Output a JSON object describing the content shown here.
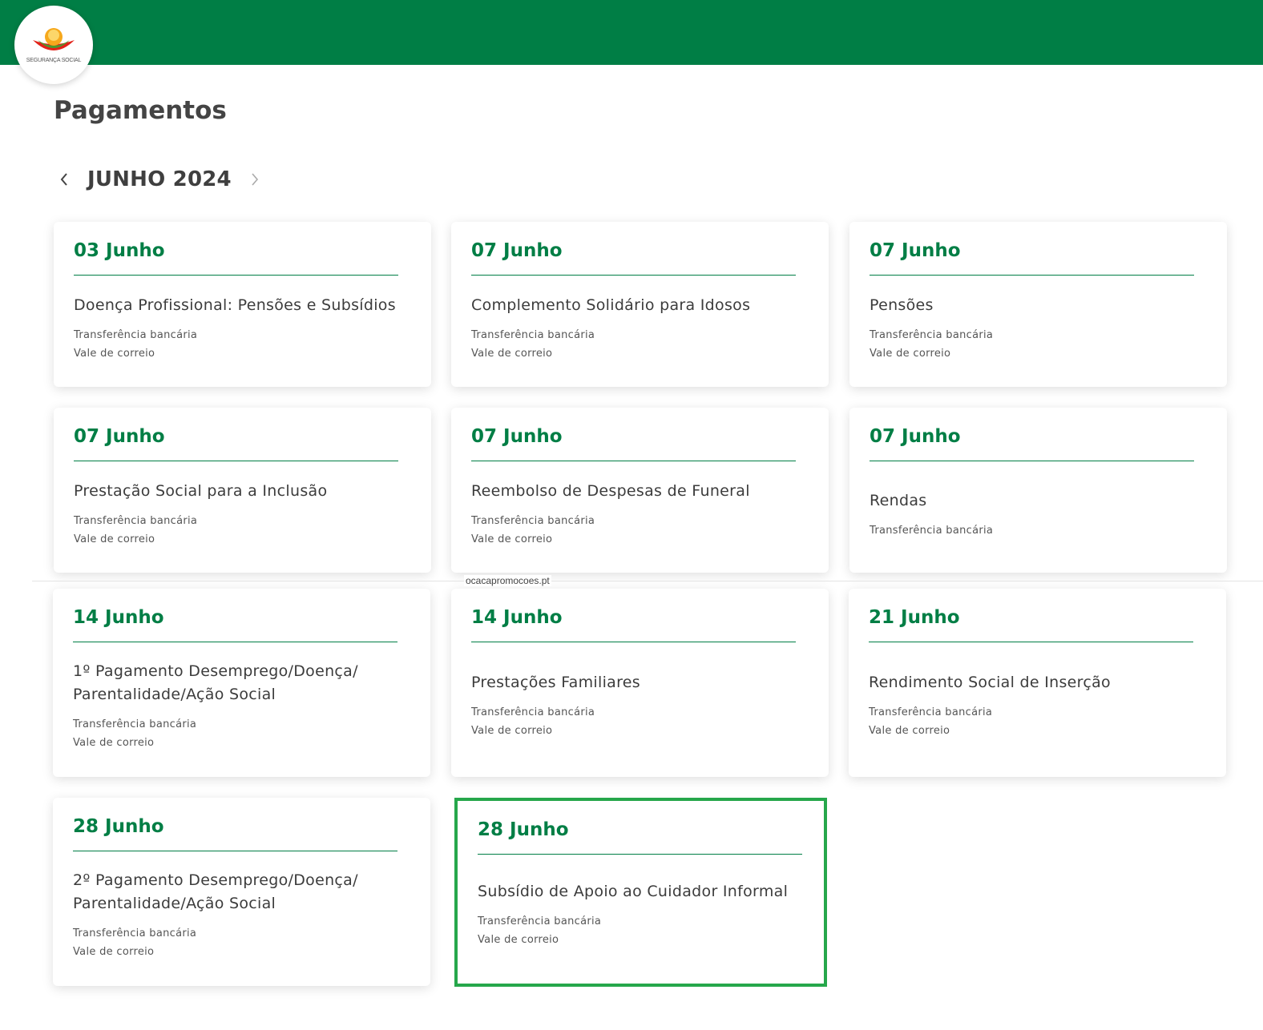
{
  "header": {
    "logo_text": "SEGURANÇA SOCIAL",
    "brand_color": "#007e45"
  },
  "page": {
    "title": "Pagamentos",
    "month": "JUNHO 2024",
    "prev_icon": "chevron-left-icon",
    "next_icon": "chevron-right-icon"
  },
  "cards": [
    {
      "date": "03 Junho",
      "title_lines": [
        "Doença Profissional: Pensões e Subsídios"
      ],
      "methods": [
        "Transferência bancária",
        "Vale de correio"
      ]
    },
    {
      "date": "07 Junho",
      "title_lines": [
        "Complemento Solidário para Idosos"
      ],
      "methods": [
        "Transferência bancária",
        "Vale de correio"
      ]
    },
    {
      "date": "07 Junho",
      "title_lines": [
        "Pensões"
      ],
      "methods": [
        "Transferência bancária",
        "Vale de correio"
      ]
    },
    {
      "date": "07 Junho",
      "title_lines": [
        "Prestação Social para a Inclusão"
      ],
      "methods": [
        "Transferência bancária",
        "Vale de correio"
      ]
    },
    {
      "date": "07 Junho",
      "title_lines": [
        "Reembolso de Despesas de Funeral"
      ],
      "methods": [
        "Transferência bancária",
        "Vale de correio"
      ]
    },
    {
      "date": "07 Junho",
      "title_lines": [
        "Rendas"
      ],
      "methods": [
        "Transferência bancária"
      ]
    },
    {
      "date": "14 Junho",
      "title_lines": [
        "1º Pagamento Desemprego/Doença/",
        "Parentalidade/Ação Social"
      ],
      "methods": [
        "Transferência bancária",
        "Vale de correio"
      ]
    },
    {
      "date": "14 Junho",
      "title_lines": [
        "Prestações Familiares"
      ],
      "methods": [
        "Transferência bancária",
        "Vale de correio"
      ]
    },
    {
      "date": "21 Junho",
      "title_lines": [
        "Rendimento Social de Inserção"
      ],
      "methods": [
        "Transferência bancária",
        "Vale de correio"
      ]
    },
    {
      "date": "28 Junho",
      "title_lines": [
        "2º Pagamento Desemprego/Doença/",
        "Parentalidade/Ação Social"
      ],
      "methods": [
        "Transferência bancária",
        "Vale de correio"
      ]
    },
    {
      "date": "28 Junho",
      "title_lines": [
        "Subsídio de Apoio ao Cuidador Informal"
      ],
      "methods": [
        "Transferência bancária",
        "Vale de correio"
      ],
      "highlighted": true
    }
  ],
  "watermark": "ocacapromocoes.pt"
}
